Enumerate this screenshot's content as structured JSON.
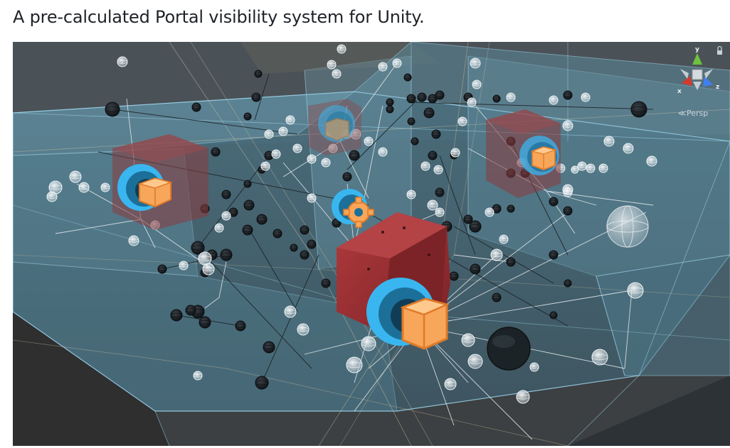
{
  "heading": "A pre-calculated Portal visibility system for Unity.",
  "scene_view": {
    "camera_mode": "Persp",
    "gizmo_axes": {
      "x": "x",
      "y": "y",
      "z": "z"
    },
    "colors": {
      "background": "#3b3f42",
      "room_fill": "#5d8a9c",
      "room_edge": "#9fd8ef",
      "portal_cube": "#9b2f33",
      "icon_blue": "#39b6ef",
      "icon_orange": "#f7a65a",
      "line_white": "#e9eef0",
      "line_dark": "#1b2024"
    },
    "icons": [
      "portal-icon",
      "occluder-box-icon",
      "settings-gear-icon",
      "probe-sphere-icon",
      "lock-icon"
    ]
  }
}
